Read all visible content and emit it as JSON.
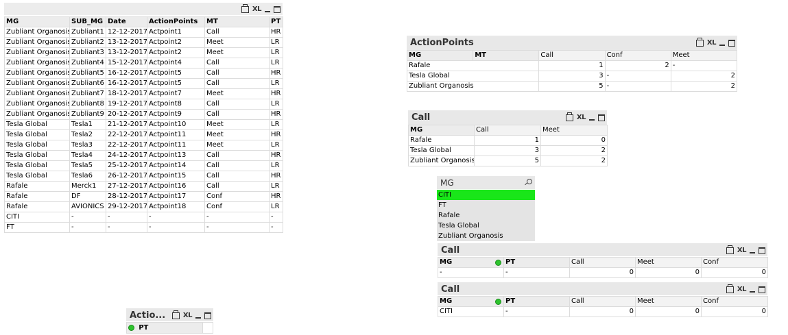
{
  "main_table": {
    "headers": [
      "MG",
      "SUB_MG",
      "Date",
      "ActionPoints",
      "MT",
      "PT"
    ],
    "rows": [
      [
        "Zubliant Organosis",
        "Zubliant1",
        "12-12-2017",
        "Actpoint1",
        "Call",
        "HR"
      ],
      [
        "Zubliant Organosis",
        "Zubliant2",
        "13-12-2017",
        "Actpoint2",
        "Meet",
        "LR"
      ],
      [
        "Zubliant Organosis",
        "Zubliant3",
        "13-12-2017",
        "Actpoint2",
        "Meet",
        "LR"
      ],
      [
        "Zubliant Organosis",
        "Zubliant4",
        "15-12-2017",
        "Actpoint4",
        "Call",
        "LR"
      ],
      [
        "Zubliant Organosis",
        "Zubliant5",
        "16-12-2017",
        "Actpoint5",
        "Call",
        "HR"
      ],
      [
        "Zubliant Organosis",
        "Zubliant6",
        "16-12-2017",
        "Actpoint5",
        "Call",
        "LR"
      ],
      [
        "Zubliant Organosis",
        "Zubliant7",
        "18-12-2017",
        "Actpoint7",
        "Meet",
        "HR"
      ],
      [
        "Zubliant Organosis",
        "Zubliant8",
        "19-12-2017",
        "Actpoint8",
        "Call",
        "LR"
      ],
      [
        "Zubliant Organosis",
        "Zubliant9",
        "20-12-2017",
        "Actpoint9",
        "Call",
        "HR"
      ],
      [
        "Tesla Global",
        "Tesla1",
        "21-12-2017",
        "Actpoint10",
        "Meet",
        "LR"
      ],
      [
        "Tesla Global",
        "Tesla2",
        "22-12-2017",
        "Actpoint11",
        "Meet",
        "HR"
      ],
      [
        "Tesla Global",
        "Tesla3",
        "22-12-2017",
        "Actpoint11",
        "Meet",
        "LR"
      ],
      [
        "Tesla Global",
        "Tesla4",
        "24-12-2017",
        "Actpoint13",
        "Call",
        "HR"
      ],
      [
        "Tesla Global",
        "Tesla5",
        "25-12-2017",
        "Actpoint14",
        "Call",
        "LR"
      ],
      [
        "Tesla Global",
        "Tesla6",
        "26-12-2017",
        "Actpoint15",
        "Call",
        "HR"
      ],
      [
        "Rafale",
        "Merck1",
        "27-12-2017",
        "Actpoint16",
        "Call",
        "LR"
      ],
      [
        "Rafale",
        "DF",
        "28-12-2017",
        "Actpoint17",
        "Conf",
        "HR"
      ],
      [
        "Rafale",
        "AVIONICS",
        "29-12-2017",
        "Actpoint18",
        "Conf",
        "LR"
      ],
      [
        "CITI",
        "-",
        "-",
        "-",
        "-",
        "-"
      ],
      [
        "FT",
        "-",
        "-",
        "-",
        "-",
        "-"
      ]
    ]
  },
  "main_caption": {
    "xl": "XL"
  },
  "actionpoints_pivot": {
    "title": "ActionPoints",
    "xl": "XL",
    "headers": [
      "MG",
      "MT",
      "Call",
      "Conf",
      "Meet"
    ],
    "rows": [
      [
        "Rafale",
        "1",
        "2",
        "-"
      ],
      [
        "Tesla Global",
        "3",
        "-",
        "2"
      ],
      [
        "Zubliant Organosis",
        "5",
        "-",
        "2"
      ]
    ]
  },
  "call_chart1": {
    "title": "Call",
    "xl": "XL",
    "headers": [
      "MG",
      "Call",
      "Meet"
    ],
    "rows": [
      [
        "Rafale",
        "1",
        "0"
      ],
      [
        "Tesla Global",
        "3",
        "2"
      ],
      [
        "Zubliant Organosis",
        "5",
        "2"
      ]
    ]
  },
  "mg_listbox": {
    "title": "MG",
    "items": [
      "CITI",
      "FT",
      "Rafale",
      "Tesla Global",
      "Zubliant Organosis"
    ],
    "selected": "CITI"
  },
  "call_chart2": {
    "title": "Call",
    "xl": "XL",
    "headers": [
      "MG",
      "PT",
      "Call",
      "Meet",
      "Conf"
    ],
    "row": [
      "-",
      "-",
      "0",
      "0",
      "0"
    ]
  },
  "call_chart3": {
    "title": "Call",
    "xl": "XL",
    "headers": [
      "MG",
      "PT",
      "Call",
      "Meet",
      "Conf"
    ],
    "row": [
      "CITI",
      "-",
      "0",
      "0",
      "0"
    ]
  },
  "small_box": {
    "title": "Actio...",
    "xl": "XL",
    "field": "PT"
  },
  "colors": {
    "selected": "#19e619",
    "caption": "#e8e8e8",
    "listbox": "#e4e4e4"
  }
}
